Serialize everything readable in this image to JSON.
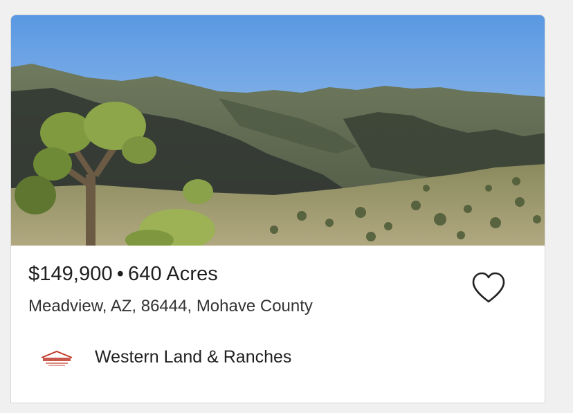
{
  "listing": {
    "price": "$149,900",
    "separator": "•",
    "acreage": "640 Acres",
    "location": "Meadview, AZ, 86444, Mohave County",
    "photo_alt": "Desert hills with Joshua trees",
    "favorite_icon": "heart-outline-icon"
  },
  "agent": {
    "name": "Western Land & Ranches",
    "logo_icon": "western-land-logo"
  },
  "colors": {
    "sky_top": "#5f9be0",
    "sky_bottom": "#b8d3ee",
    "text_primary": "#1f1f1f",
    "text_secondary": "#333333",
    "logo_red": "#c0392b"
  }
}
